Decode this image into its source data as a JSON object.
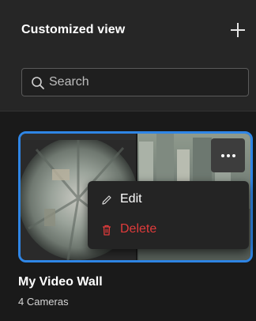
{
  "panel": {
    "title": "Customized view",
    "add_icon": "plus-icon"
  },
  "search": {
    "placeholder": "Search",
    "value": "",
    "icon": "search-icon"
  },
  "video_walls": [
    {
      "name": "My Video Wall",
      "camera_count": "4 Cameras",
      "selected": true,
      "accent_color": "#2f86e6"
    }
  ],
  "context_menu": {
    "trigger_icon": "more-horizontal-icon",
    "items": [
      {
        "label": "Edit",
        "icon": "pencil-icon",
        "color": "#ffffff"
      },
      {
        "label": "Delete",
        "icon": "trash-icon",
        "color": "#e03b3b"
      }
    ]
  }
}
